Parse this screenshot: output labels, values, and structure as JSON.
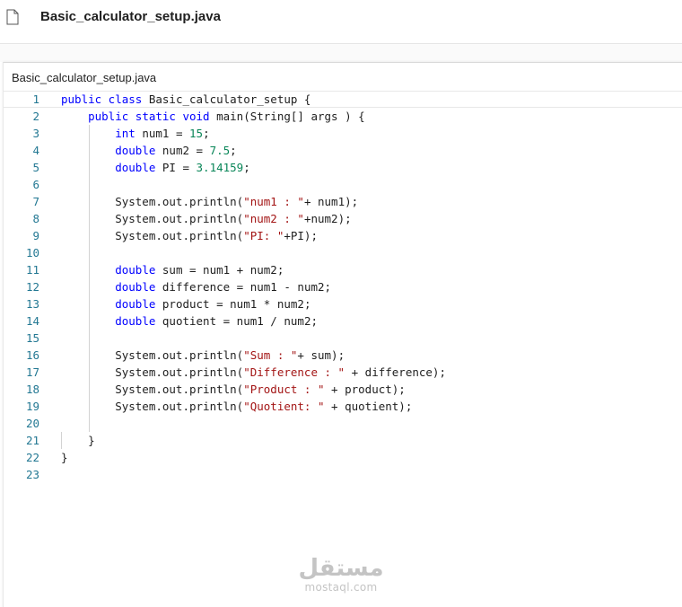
{
  "header": {
    "file_icon": "document-icon",
    "title": "Basic_calculator_setup.java"
  },
  "editor": {
    "tab_label": "Basic_calculator_setup.java",
    "colors": {
      "keyword": "#0000ff",
      "number": "#098658",
      "string": "#a31515",
      "line_number": "#237893"
    },
    "lines": [
      {
        "n": "1",
        "tokens": [
          [
            "kw",
            "public class"
          ],
          [
            "p",
            " Basic_calculator_setup {"
          ]
        ]
      },
      {
        "n": "2",
        "tokens": [
          [
            "p",
            "    "
          ],
          [
            "kw",
            "public static void"
          ],
          [
            "p",
            " main(String[] args ) {"
          ]
        ]
      },
      {
        "n": "3",
        "tokens": [
          [
            "p",
            "        "
          ],
          [
            "kw",
            "int"
          ],
          [
            "p",
            " num1 = "
          ],
          [
            "num",
            "15"
          ],
          [
            "p",
            ";"
          ]
        ]
      },
      {
        "n": "4",
        "tokens": [
          [
            "p",
            "        "
          ],
          [
            "kw",
            "double"
          ],
          [
            "p",
            " num2 = "
          ],
          [
            "num",
            "7.5"
          ],
          [
            "p",
            ";"
          ]
        ]
      },
      {
        "n": "5",
        "tokens": [
          [
            "p",
            "        "
          ],
          [
            "kw",
            "double"
          ],
          [
            "p",
            " PI = "
          ],
          [
            "num",
            "3.14159"
          ],
          [
            "p",
            ";"
          ]
        ]
      },
      {
        "n": "6",
        "tokens": []
      },
      {
        "n": "7",
        "tokens": [
          [
            "p",
            "        System.out.println("
          ],
          [
            "str",
            "\"num1 : \""
          ],
          [
            "p",
            "+ num1);"
          ]
        ]
      },
      {
        "n": "8",
        "tokens": [
          [
            "p",
            "        System.out.println("
          ],
          [
            "str",
            "\"num2 : \""
          ],
          [
            "p",
            "+num2);"
          ]
        ]
      },
      {
        "n": "9",
        "tokens": [
          [
            "p",
            "        System.out.println("
          ],
          [
            "str",
            "\"PI: \""
          ],
          [
            "p",
            "+PI);"
          ]
        ]
      },
      {
        "n": "10",
        "tokens": []
      },
      {
        "n": "11",
        "tokens": [
          [
            "p",
            "        "
          ],
          [
            "kw",
            "double"
          ],
          [
            "p",
            " sum = num1 + num2;"
          ]
        ]
      },
      {
        "n": "12",
        "tokens": [
          [
            "p",
            "        "
          ],
          [
            "kw",
            "double"
          ],
          [
            "p",
            " difference = num1 - num2;"
          ]
        ]
      },
      {
        "n": "13",
        "tokens": [
          [
            "p",
            "        "
          ],
          [
            "kw",
            "double"
          ],
          [
            "p",
            " product = num1 * num2;"
          ]
        ]
      },
      {
        "n": "14",
        "tokens": [
          [
            "p",
            "        "
          ],
          [
            "kw",
            "double"
          ],
          [
            "p",
            " quotient = num1 / num2;"
          ]
        ]
      },
      {
        "n": "15",
        "tokens": []
      },
      {
        "n": "16",
        "tokens": [
          [
            "p",
            "        System.out.println("
          ],
          [
            "str",
            "\"Sum : \""
          ],
          [
            "p",
            "+ sum);"
          ]
        ]
      },
      {
        "n": "17",
        "tokens": [
          [
            "p",
            "        System.out.println("
          ],
          [
            "str",
            "\"Difference : \""
          ],
          [
            "p",
            " + difference);"
          ]
        ]
      },
      {
        "n": "18",
        "tokens": [
          [
            "p",
            "        System.out.println("
          ],
          [
            "str",
            "\"Product : \""
          ],
          [
            "p",
            " + product);"
          ]
        ]
      },
      {
        "n": "19",
        "tokens": [
          [
            "p",
            "        System.out.println("
          ],
          [
            "str",
            "\"Quotient: \""
          ],
          [
            "p",
            " + quotient);"
          ]
        ]
      },
      {
        "n": "20",
        "tokens": []
      },
      {
        "n": "21",
        "tokens": [
          [
            "p",
            "    }"
          ]
        ]
      },
      {
        "n": "22",
        "tokens": [
          [
            "p",
            "}"
          ]
        ]
      },
      {
        "n": "23",
        "tokens": []
      }
    ]
  },
  "watermark": {
    "arabic": "مستقل",
    "latin": "mostaql.com"
  }
}
